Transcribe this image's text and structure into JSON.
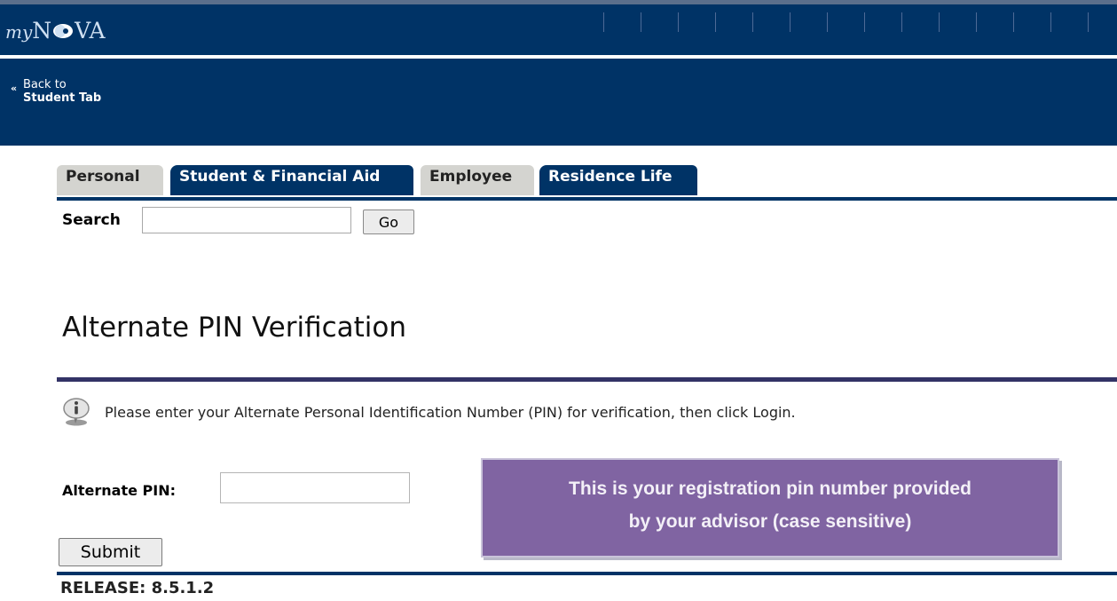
{
  "header": {
    "logo_prefix": "my",
    "logo_n": "N",
    "logo_suffix": "VA",
    "back_line1": "Back to",
    "back_line2": "Student Tab"
  },
  "tabs": [
    {
      "label": "Personal",
      "active": false
    },
    {
      "label": "Student & Financial Aid",
      "active": true
    },
    {
      "label": "Employee",
      "active": false
    },
    {
      "label": "Residence Life",
      "active": true
    }
  ],
  "search": {
    "label": "Search",
    "value": "",
    "button": "Go"
  },
  "page": {
    "title": "Alternate PIN Verification",
    "info": "Please enter your Alternate Personal Identification Number (PIN) for verification, then click Login.",
    "pin_label": "Alternate PIN:",
    "pin_value": "",
    "submit": "Submit",
    "release": "RELEASE: 8.5.1.2"
  },
  "callout": {
    "line1": "This is your registration pin number provided",
    "line2": "by your advisor (case sensitive)"
  },
  "colors": {
    "brand_navy": "#003366",
    "callout_purple": "#8064a2"
  },
  "icons": {
    "info": "info-icon",
    "back": "double-chevron-left-icon"
  }
}
